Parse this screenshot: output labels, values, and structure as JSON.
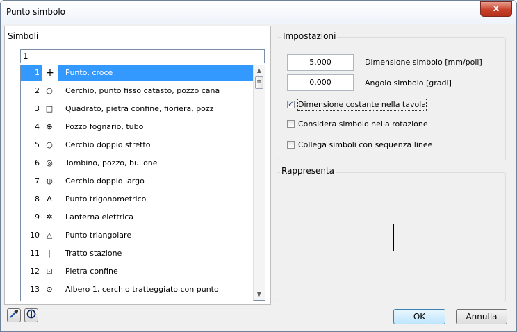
{
  "window": {
    "title": "Punto simbolo",
    "close_glyph": "x"
  },
  "symbols": {
    "header": "Simboli",
    "filter_value": "1",
    "items": [
      {
        "num": "1",
        "icon": "plus-icon",
        "glyph": "+",
        "label": "Punto, croce",
        "selected": true
      },
      {
        "num": "2",
        "icon": "circle-icon",
        "glyph": "○",
        "label": "Cerchio, punto fisso catasto, pozzo cana"
      },
      {
        "num": "3",
        "icon": "square-icon",
        "glyph": "□",
        "label": "Quadrato, pietra confine, fioriera, pozz"
      },
      {
        "num": "4",
        "icon": "circle-plus-icon",
        "glyph": "⊕",
        "label": "Pozzo fognario, tubo"
      },
      {
        "num": "5",
        "icon": "circle-icon",
        "glyph": "○",
        "label": "Cerchio doppio stretto"
      },
      {
        "num": "6",
        "icon": "double-circle-icon",
        "glyph": "◎",
        "label": "Tombino, pozzo, bullone"
      },
      {
        "num": "7",
        "icon": "hatched-circle-icon",
        "glyph": "◍",
        "label": "Cerchio doppio largo"
      },
      {
        "num": "8",
        "icon": "triangle-icon",
        "glyph": "Δ",
        "label": "Punto trigonometrico"
      },
      {
        "num": "9",
        "icon": "lamp-icon",
        "glyph": "✲",
        "label": "Lanterna elettrica"
      },
      {
        "num": "10",
        "icon": "triangle-icon",
        "glyph": "△",
        "label": "Punto triangolare"
      },
      {
        "num": "11",
        "icon": "bar-icon",
        "glyph": "|",
        "label": "Tratto stazione"
      },
      {
        "num": "12",
        "icon": "square-dot-icon",
        "glyph": "⊡",
        "label": "Pietra confine"
      },
      {
        "num": "13",
        "icon": "circle-dot-icon",
        "glyph": "⊙",
        "label": "Albero 1, cerchio tratteggiato con punto"
      }
    ]
  },
  "settings": {
    "header": "Impostazioni",
    "size_value": "5.000",
    "size_label": "Dimensione simbolo [mm/poll]",
    "angle_value": "0.000",
    "angle_label": "Angolo simbolo [gradi]",
    "checkboxes": [
      {
        "label": "Dimensione costante nella tavola",
        "checked": true
      },
      {
        "label": "Considera simbolo nella rotazione",
        "checked": false
      },
      {
        "label": "Collega simboli con sequenza linee",
        "checked": false
      }
    ]
  },
  "preview": {
    "header": "Rappresenta"
  },
  "buttons": {
    "ok": "OK",
    "cancel": "Annulla",
    "pipette_icon": "pipette-icon",
    "info_icon": "info-icon"
  },
  "colors": {
    "selection": "#3399ff",
    "close_button": "#c7412a"
  }
}
